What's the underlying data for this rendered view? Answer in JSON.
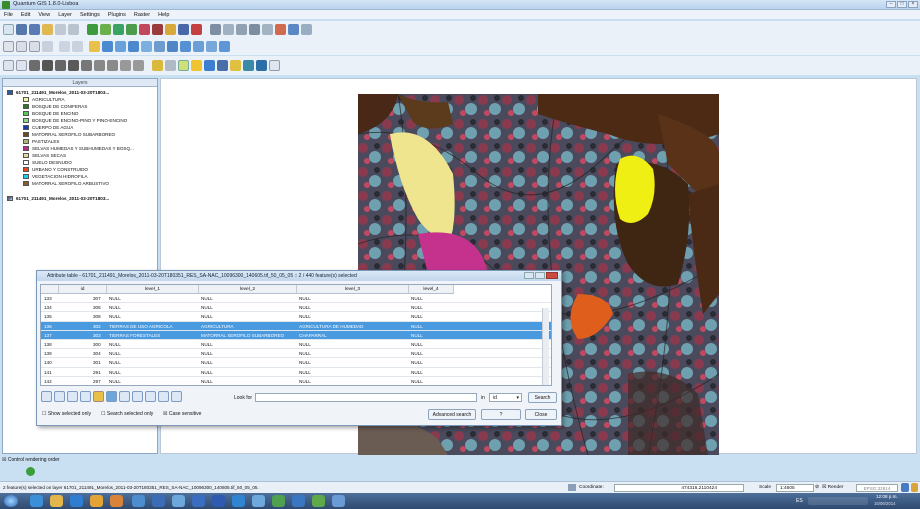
{
  "window": {
    "title": "Quantum GIS 1.8.0-Lisboa"
  },
  "menu": [
    "File",
    "Edit",
    "View",
    "Layer",
    "Settings",
    "Plugins",
    "Raster",
    "Help"
  ],
  "layers_panel": {
    "title": "Layers",
    "group1": "61701_211491_Morelos_2011-03-20T1803...",
    "classes": [
      {
        "label": "AGRICULTURA",
        "color": "#f1f1a6"
      },
      {
        "label": "BOSQUE DE CONIFERAS",
        "color": "#2b7a2b"
      },
      {
        "label": "BOSQUE DE ENCINO",
        "color": "#57c957"
      },
      {
        "label": "BOSQUE DE ENCINO-PINO Y PINO-ENCINO",
        "color": "#8cd98c"
      },
      {
        "label": "CUERPO DE AGUA",
        "color": "#1538b5"
      },
      {
        "label": "MATORRAL XEROFILO SUBARBOREO",
        "color": "#6b4a2a"
      },
      {
        "label": "PASTIZALES",
        "color": "#b1b76c"
      },
      {
        "label": "SELVAS HUMEDAS Y SUBHUMEDAS Y BOSQ...",
        "color": "#c2278f"
      },
      {
        "label": "SELVAS SECAS",
        "color": "#e6d8a3"
      },
      {
        "label": "SUELO DESNUDO",
        "color": "#ffffff"
      },
      {
        "label": "URBANO Y CONSTRUIDO",
        "color": "#e34b1b"
      },
      {
        "label": "VEGETACION HIDROFILA",
        "color": "#17d0e8"
      },
      {
        "label": "MATORRAL XEROFILO ARBUSTIVO",
        "color": "#8d5a2c"
      }
    ],
    "group2": "61701_211491_Morelos_2011-03-20T1803..."
  },
  "attribute_table": {
    "title": "Attribute table - 61701_211491_Morelos_2011-03-20T180351_RES_SA-NAC_10096300_140605.tif_50_05_05 :: 2 / 440 feature(s) selected",
    "columns": [
      "id",
      "level_1",
      "level_2",
      "level_3",
      "level_4"
    ],
    "rows": [
      {
        "n": "133",
        "id": "307",
        "l1": "NULL",
        "l2": "NULL",
        "l3": "NULL",
        "l4": "NULL",
        "sel": false
      },
      {
        "n": "134",
        "id": "306",
        "l1": "NULL",
        "l2": "NULL",
        "l3": "NULL",
        "l4": "NULL",
        "sel": false
      },
      {
        "n": "135",
        "id": "308",
        "l1": "NULL",
        "l2": "NULL",
        "l3": "NULL",
        "l4": "NULL",
        "sel": false
      },
      {
        "n": "136",
        "id": "302",
        "l1": "TIERRAS DE USO AGRICOLA",
        "l2": "AGRICULTURA",
        "l3": "AGRICULTURA DE HUMEDAD",
        "l4": "NULL",
        "sel": true
      },
      {
        "n": "137",
        "id": "303",
        "l1": "TIERRAS FORESTALES",
        "l2": "MATORRAL XEROFILO SUBARBOREO",
        "l3": "CHAPARRAL",
        "l4": "NULL",
        "sel": true
      },
      {
        "n": "138",
        "id": "300",
        "l1": "NULL",
        "l2": "NULL",
        "l3": "NULL",
        "l4": "NULL",
        "sel": false
      },
      {
        "n": "139",
        "id": "304",
        "l1": "NULL",
        "l2": "NULL",
        "l3": "NULL",
        "l4": "NULL",
        "sel": false
      },
      {
        "n": "140",
        "id": "301",
        "l1": "NULL",
        "l2": "NULL",
        "l3": "NULL",
        "l4": "NULL",
        "sel": false
      },
      {
        "n": "141",
        "id": "291",
        "l1": "NULL",
        "l2": "NULL",
        "l3": "NULL",
        "l4": "NULL",
        "sel": false
      },
      {
        "n": "142",
        "id": "297",
        "l1": "NULL",
        "l2": "NULL",
        "l3": "NULL",
        "l4": "NULL",
        "sel": false
      }
    ],
    "look_for": "Look for",
    "in_label": "in",
    "field_value": "id",
    "search_btn": "Search",
    "show_selected": "Show selected only",
    "search_selected": "Search selected only",
    "case_sensitive": "Case sensitive",
    "advanced": "Advanced search",
    "help": "?",
    "close": "Close"
  },
  "control_rendering": "Control rendering order",
  "status": {
    "message": "2 feature(s) selected on layer 61701_211491_Morelos_2011-03-20T180351_RES_SA-NAC_10096300_140605.tif_50_05_05.",
    "coordinate_label": "Coordinate:",
    "coordinate_value": "474316,2110424",
    "scale_label": "Scale",
    "scale_value": "1:4605",
    "render_label": "Render",
    "epsg": "EPSG:32614"
  },
  "taskbar": {
    "time": "12:08 p.m.",
    "date": "16/06/2014",
    "lang": "ES"
  }
}
